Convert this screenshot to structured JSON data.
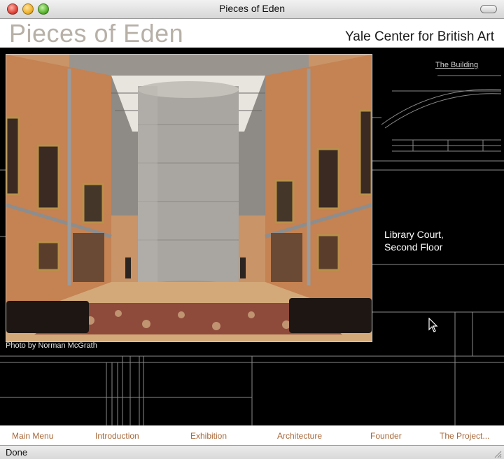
{
  "window": {
    "title": "Pieces of Eden"
  },
  "header": {
    "logo": "Pieces of Eden",
    "subtitle": "Yale Center for British Art"
  },
  "photo": {
    "credit": "Photo by Norman McGrath"
  },
  "side": {
    "building_link": "The Building",
    "caption_line1": "Library Court,",
    "caption_line2": "Second Floor"
  },
  "nav": {
    "items": [
      "Main Menu",
      "Introduction",
      "Exhibition",
      "Architecture",
      "Founder",
      "The Project..."
    ]
  },
  "status": {
    "text": "Done"
  },
  "colors": {
    "nav_text": "#a8683a",
    "logo": "#b7b0a7",
    "stage_bg": "#000000"
  },
  "icons": [
    "close-icon",
    "minimize-icon",
    "zoom-icon",
    "toolbar-toggle-icon",
    "pointer-cursor-icon",
    "resize-grip-icon"
  ]
}
